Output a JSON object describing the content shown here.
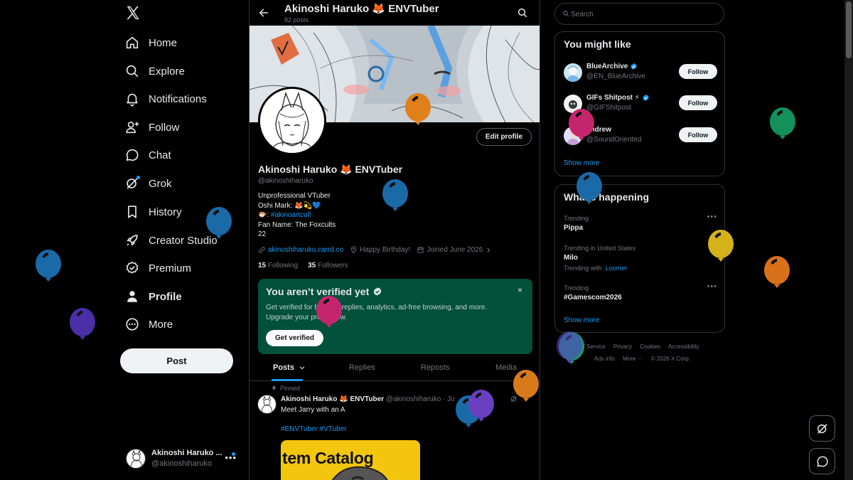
{
  "nav": {
    "items": [
      {
        "label": "Home",
        "icon": "home-icon"
      },
      {
        "label": "Explore",
        "icon": "search-icon"
      },
      {
        "label": "Notifications",
        "icon": "bell-icon"
      },
      {
        "label": "Follow",
        "icon": "person-add-icon"
      },
      {
        "label": "Chat",
        "icon": "chat-icon"
      },
      {
        "label": "Grok",
        "icon": "grok-icon"
      },
      {
        "label": "History",
        "icon": "bookmark-icon"
      },
      {
        "label": "Creator Studio",
        "icon": "rocket-icon"
      },
      {
        "label": "Premium",
        "icon": "verified-icon"
      },
      {
        "label": "Profile",
        "icon": "person-icon"
      },
      {
        "label": "More",
        "icon": "more-circle-icon"
      }
    ],
    "post_label": "Post"
  },
  "account": {
    "name": "Akinoshi Haruko ...",
    "handle": "@akinoshiharuko",
    "more": "•••"
  },
  "header": {
    "title": "Akinoshi Haruko 🦊 ENVTuber",
    "posts_count": "82 posts"
  },
  "profile": {
    "edit_label": "Edit profile",
    "name": "Akinoshi Haruko 🦊 ENVTuber",
    "handle": "@akinoshiharuko",
    "bio": {
      "line1": "Unprofessional VTuber",
      "line2": "Oshi Mark: 🦊💫💙",
      "line3_prefix": "🐡: ",
      "line3_link": "#akinoartcult",
      "line4": "Fan Name: The Foxcults",
      "line5": "22"
    },
    "website": "akinoshiharuko.carrd.co",
    "birthday": "Happy Birthday!",
    "joined": "Joined June 2026",
    "following_count": "15",
    "following_label": "Following",
    "followers_count": "35",
    "followers_label": "Followers"
  },
  "verify_card": {
    "title": "You aren’t verified yet",
    "description": "Get verified for boosted replies, analytics, ad-free browsing, and more. Upgrade your profile now.",
    "button": "Get verified",
    "close": "×"
  },
  "tabs": [
    {
      "label": "Posts"
    },
    {
      "label": "Replies"
    },
    {
      "label": "Reposts"
    },
    {
      "label": "Media"
    }
  ],
  "pinned_post": {
    "pinned_label": "Pinned",
    "author": "Akinoshi Haruko 🦊 ENVTuber",
    "meta": "@akinoshiharuko · Ju",
    "text": "Meet Jarry with an A",
    "tags": "#ENVTuber #VTuber",
    "media_text": "tem Catalog"
  },
  "search": {
    "placeholder": "Search"
  },
  "you_might_like": {
    "title": "You might like",
    "items": [
      {
        "name": "BlueArchive",
        "handle": "@EN_BlueArchive",
        "verified": true,
        "follow": "Follow"
      },
      {
        "name": "GIFs Shitpost ⚡",
        "handle": "@GIFShitpost",
        "verified": true,
        "follow": "Follow"
      },
      {
        "name": "andrew",
        "handle": "@SoundOriented",
        "verified": false,
        "follow": "Follow"
      }
    ],
    "show_more": "Show more"
  },
  "whats_happening": {
    "title": "What’s happening",
    "trends": [
      {
        "context": "Trending",
        "name": "Pippa",
        "with": ""
      },
      {
        "context": "Trending in United States",
        "name": "Milo",
        "with_prefix": "Trending with",
        "with": "Loomer"
      },
      {
        "context": "Trending",
        "name": "#Gamescom2026",
        "with": ""
      }
    ],
    "more_icon": "•••",
    "show_more": "Show more"
  },
  "footer": {
    "row1": [
      "Terms of Service",
      "Privacy",
      "Cookies",
      "Accessibility"
    ],
    "row2": [
      "Ads info",
      "More ···",
      "© 2026 X Corp."
    ]
  },
  "colors": {
    "accent": "#1d9bf0",
    "verify_bg": "#00503a",
    "background": "#000000",
    "border": "#2f3336",
    "muted": "#71767b"
  },
  "balloons": [
    {
      "color": "#1a6aa8"
    },
    {
      "color": "#4a2fa8"
    },
    {
      "color": "#1a6aa8"
    },
    {
      "color": "#1a6aa8"
    },
    {
      "color": "#c4266e"
    },
    {
      "color": "#e0801a"
    },
    {
      "color": "#c4266e"
    },
    {
      "color": "#1a6aa8"
    },
    {
      "color": "#1a6aa8"
    },
    {
      "color": "#6a3fc0"
    },
    {
      "color": "#d97a1a"
    },
    {
      "color": "#1a9a74"
    },
    {
      "color": "#5a3fc0"
    },
    {
      "color": "#14905a"
    },
    {
      "color": "#d4b21a"
    },
    {
      "color": "#d9701a"
    }
  ]
}
